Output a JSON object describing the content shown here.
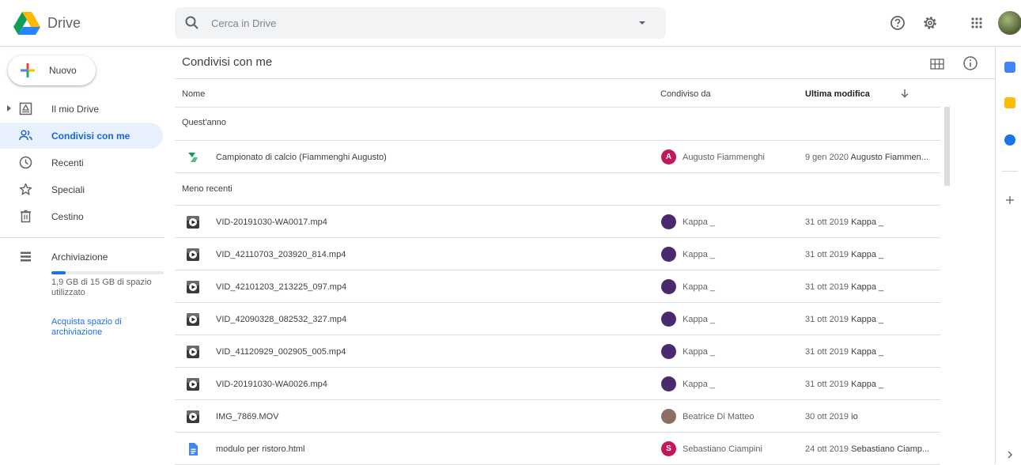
{
  "app": {
    "name": "Drive"
  },
  "search": {
    "placeholder": "Cerca in Drive"
  },
  "sidebar": {
    "new_label": "Nuovo",
    "items": [
      {
        "label": "Il mio Drive",
        "icon": "my-drive-icon"
      },
      {
        "label": "Condivisi con me",
        "icon": "shared-with-me-icon",
        "active": true
      },
      {
        "label": "Recenti",
        "icon": "recent-icon"
      },
      {
        "label": "Speciali",
        "icon": "star-icon"
      },
      {
        "label": "Cestino",
        "icon": "trash-icon"
      }
    ],
    "storage": {
      "label": "Archiviazione",
      "used_fraction": 0.127,
      "text": "1,9 GB di 15 GB di spazio utilizzato",
      "buy_label": "Acquista spazio di archiviazione"
    }
  },
  "main": {
    "title": "Condivisi con me",
    "columns": {
      "name": "Nome",
      "shared_by": "Condiviso da",
      "modified": "Ultima modifica"
    },
    "sections": [
      {
        "label": "Quest'anno"
      },
      {
        "label": "Meno recenti"
      }
    ],
    "files": [
      {
        "name": "Campionato di calcio (Fiammenghi Augusto)",
        "type": "sheet",
        "owner": "Augusto Fiammenghi",
        "avatar": "A",
        "avatar_color": "#c2185b",
        "date": "9 gen 2020",
        "by": "Augusto Fiammen..."
      },
      {
        "name": "VID-20191030-WA0017.mp4",
        "type": "video",
        "owner": "Kappa _",
        "avatar": "",
        "avatar_color": "#4a2a6e",
        "date": "31 ott 2019",
        "by": "Kappa _"
      },
      {
        "name": "VID_42110703_203920_814.mp4",
        "type": "video",
        "owner": "Kappa _",
        "avatar": "",
        "avatar_color": "#4a2a6e",
        "date": "31 ott 2019",
        "by": "Kappa _"
      },
      {
        "name": "VID_42101203_213225_097.mp4",
        "type": "video",
        "owner": "Kappa _",
        "avatar": "",
        "avatar_color": "#4a2a6e",
        "date": "31 ott 2019",
        "by": "Kappa _"
      },
      {
        "name": "VID_42090328_082532_327.mp4",
        "type": "video",
        "owner": "Kappa _",
        "avatar": "",
        "avatar_color": "#4a2a6e",
        "date": "31 ott 2019",
        "by": "Kappa _"
      },
      {
        "name": "VID_41120929_002905_005.mp4",
        "type": "video",
        "owner": "Kappa _",
        "avatar": "",
        "avatar_color": "#4a2a6e",
        "date": "31 ott 2019",
        "by": "Kappa _"
      },
      {
        "name": "VID-20191030-WA0026.mp4",
        "type": "video",
        "owner": "Kappa _",
        "avatar": "",
        "avatar_color": "#4a2a6e",
        "date": "31 ott 2019",
        "by": "Kappa _"
      },
      {
        "name": "IMG_7869.MOV",
        "type": "video",
        "owner": "Beatrice Di Matteo",
        "avatar": "",
        "avatar_color": "#8d6e63",
        "date": "30 ott 2019",
        "by": "io"
      },
      {
        "name": "modulo per ristoro.html",
        "type": "doc",
        "owner": "Sebastiano Ciampini",
        "avatar": "S",
        "avatar_color": "#c2185b",
        "date": "24 ott 2019",
        "by": "Sebastiano Ciamp..."
      }
    ]
  },
  "colors": {
    "accent": "#1a73e8",
    "active_bg": "#e8f0fe",
    "active_text": "#1967d2"
  }
}
